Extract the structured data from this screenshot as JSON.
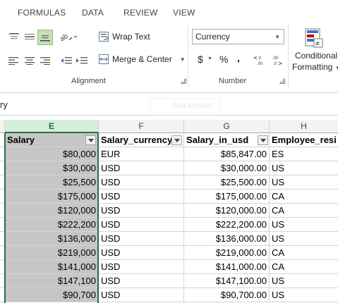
{
  "ribbon_tabs": [
    "FORMULAS",
    "DATA",
    "REVIEW",
    "VIEW"
  ],
  "alignment": {
    "wrap_text_label": "Wrap Text",
    "merge_center_label": "Merge & Center",
    "group_label": "Alignment"
  },
  "number": {
    "format_value": "Currency",
    "currency_symbol": "$",
    "percent_symbol": "%",
    "comma_symbol": ",",
    "increase_decimal_label": "←.0 .00",
    "decrease_decimal_label": ".00 →.0",
    "group_label": "Number"
  },
  "styles": {
    "conditional_formatting_line1": "Conditional",
    "conditional_formatting_line2": "Formatting"
  },
  "formula_bar": {
    "content": "ry"
  },
  "grid": {
    "column_headers": [
      "E",
      "F",
      "G",
      "H"
    ],
    "selected_column": "E",
    "header_row": [
      "Salary",
      "Salary_currency",
      "Salary_in_usd",
      "Employee_resi"
    ],
    "rows": [
      [
        "$80,000",
        "EUR",
        "$85,847.00",
        "ES"
      ],
      [
        "$30,000",
        "USD",
        "$30,000.00",
        "US"
      ],
      [
        "$25,500",
        "USD",
        "$25,500.00",
        "US"
      ],
      [
        "$175,000",
        "USD",
        "$175,000.00",
        "CA"
      ],
      [
        "$120,000",
        "USD",
        "$120,000.00",
        "CA"
      ],
      [
        "$222,200",
        "USD",
        "$222,200.00",
        "US"
      ],
      [
        "$136,000",
        "USD",
        "$136,000.00",
        "US"
      ],
      [
        "$219,000",
        "USD",
        "$219,000.00",
        "CA"
      ],
      [
        "$141,000",
        "USD",
        "$141,000.00",
        "CA"
      ],
      [
        "$147,100",
        "USD",
        "$147,100.00",
        "US"
      ],
      [
        "$90,700",
        "USD",
        "$90,700.00",
        "US"
      ]
    ]
  },
  "overlay": {
    "ghost_text": "Full-screen"
  },
  "colors": {
    "accent": "#217346",
    "selection_fill": "#c6c6c6",
    "selected_header_fill": "#d3eedb",
    "active_align_button": "#c5e0b3"
  },
  "icons": [
    "align-top-icon",
    "align-middle-icon",
    "align-bottom-icon",
    "orientation-icon",
    "wrap-text-icon",
    "align-left-icon",
    "align-center-icon",
    "align-right-icon",
    "decrease-indent-icon",
    "increase-indent-icon",
    "merge-center-icon",
    "dialog-launcher-icon",
    "conditional-formatting-icon",
    "filter-dropdown-icon"
  ]
}
